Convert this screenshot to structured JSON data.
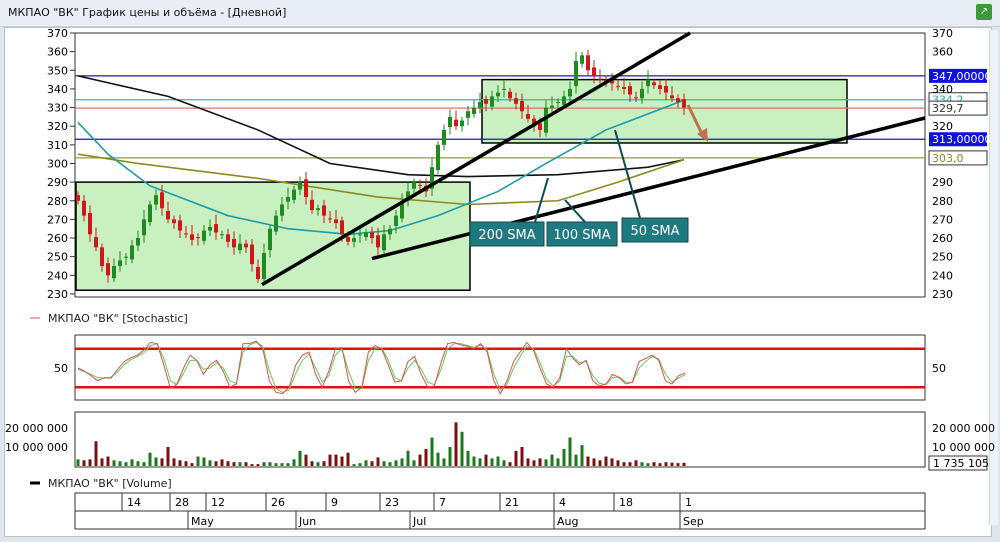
{
  "window": {
    "title": "МКПАО \"ВК\" График цены и объёма - [Дневной]",
    "pin_icon": "pin-icon"
  },
  "price_panel": {
    "y_ticks": [
      370,
      360,
      350,
      340,
      330,
      320,
      310,
      300,
      290,
      280,
      270,
      260,
      250,
      240,
      230
    ],
    "levels": [
      {
        "value": 347,
        "label": "347,00000",
        "color": "#1a1ab0",
        "tag_bg": "#1010e0",
        "tag_fg": "#ffffff"
      },
      {
        "value": 313,
        "label": "313,00000",
        "color": "#1a1ab0",
        "tag_bg": "#1010e0",
        "tag_fg": "#ffffff"
      },
      {
        "value": 334.2,
        "label": "334,2",
        "color": "#39b3b3",
        "tag_bg": "#ffffff",
        "tag_fg": "#39a0b0"
      },
      {
        "value": 329.7,
        "label": "329,7",
        "color": "#e07070",
        "tag_bg": "#ffffff",
        "tag_fg": "#333333"
      },
      {
        "value": 303.0,
        "label": "303,0",
        "color": "#9a9a40",
        "tag_bg": "#ffffff",
        "tag_fg": "#8a8a30"
      }
    ],
    "callouts": {
      "sma200": "200 SMA",
      "sma100": "100 SMA",
      "sma50": "50 SMA"
    },
    "closes": [
      280,
      272,
      262,
      255,
      245,
      240,
      245,
      248,
      250,
      256,
      260,
      270,
      278,
      283,
      276,
      270,
      268,
      264,
      262,
      259,
      260,
      264,
      266,
      263,
      262,
      258,
      255,
      257,
      255,
      246,
      238,
      252,
      265,
      272,
      278,
      282,
      286,
      290,
      282,
      275,
      276,
      272,
      270,
      268,
      262,
      258,
      260,
      262,
      263,
      260,
      255,
      262,
      265,
      272,
      280,
      285,
      290,
      288,
      285,
      298,
      310,
      318,
      325,
      320,
      323,
      328,
      330,
      333,
      332,
      336,
      338,
      340,
      335,
      332,
      328,
      324,
      320,
      318,
      330,
      331,
      333,
      336,
      340,
      355,
      358,
      350,
      347,
      345,
      344,
      343,
      341,
      340,
      337,
      335,
      340,
      345,
      342,
      340,
      338,
      335,
      333,
      330
    ],
    "sma200": [
      [
        0,
        347
      ],
      [
        15,
        336
      ],
      [
        30,
        318
      ],
      [
        42,
        300
      ],
      [
        55,
        294
      ],
      [
        65,
        293
      ],
      [
        80,
        294
      ],
      [
        95,
        298
      ],
      [
        101,
        302
      ]
    ],
    "sma100": [
      [
        0,
        305
      ],
      [
        10,
        300
      ],
      [
        30,
        292
      ],
      [
        50,
        282
      ],
      [
        65,
        278
      ],
      [
        80,
        280
      ],
      [
        90,
        290
      ],
      [
        101,
        302
      ]
    ],
    "sma50": [
      [
        0,
        322
      ],
      [
        5,
        305
      ],
      [
        12,
        288
      ],
      [
        25,
        272
      ],
      [
        35,
        265
      ],
      [
        45,
        262
      ],
      [
        52,
        264
      ],
      [
        60,
        272
      ],
      [
        70,
        285
      ],
      [
        78,
        300
      ],
      [
        88,
        318
      ],
      [
        101,
        334
      ]
    ]
  },
  "stochastic_panel": {
    "legend": "МКПАО \"ВК\" [Stochastic]",
    "y_tick": "50",
    "upper": 80,
    "lower": 20,
    "k": [
      50,
      45,
      38,
      30,
      35,
      34,
      48,
      60,
      66,
      70,
      78,
      90,
      88,
      55,
      18,
      25,
      50,
      70,
      62,
      40,
      55,
      62,
      45,
      20,
      25,
      88,
      88,
      92,
      80,
      30,
      12,
      10,
      20,
      55,
      70,
      75,
      40,
      20,
      45,
      80,
      82,
      30,
      12,
      20,
      75,
      85,
      80,
      55,
      28,
      30,
      60,
      68,
      40,
      20,
      22,
      58,
      88,
      90,
      86,
      84,
      80,
      88,
      75,
      30,
      10,
      30,
      60,
      75,
      90,
      78,
      50,
      25,
      20,
      35,
      80,
      65,
      55,
      62,
      30,
      22,
      25,
      40,
      35,
      25,
      28,
      60,
      65,
      70,
      62,
      30,
      25,
      38,
      42
    ],
    "d": [
      48,
      44,
      40,
      35,
      34,
      36,
      44,
      55,
      63,
      68,
      74,
      85,
      88,
      65,
      30,
      24,
      42,
      62,
      62,
      48,
      50,
      58,
      50,
      30,
      26,
      75,
      86,
      90,
      84,
      45,
      18,
      12,
      16,
      42,
      62,
      72,
      50,
      28,
      38,
      70,
      80,
      45,
      18,
      18,
      62,
      80,
      82,
      62,
      35,
      30,
      50,
      62,
      48,
      28,
      24,
      48,
      80,
      88,
      88,
      85,
      82,
      86,
      78,
      40,
      16,
      25,
      50,
      68,
      85,
      80,
      58,
      32,
      22,
      30,
      68,
      68,
      58,
      60,
      38,
      26,
      24,
      35,
      36,
      28,
      27,
      50,
      60,
      68,
      64,
      40,
      28,
      34,
      40
    ]
  },
  "volume_panel": {
    "legend": "МКПАО \"ВК\" [Volume]",
    "y_ticks": [
      "20 000 000",
      "10 000 000"
    ],
    "last_value": "1 735 105",
    "volumes": [
      3.5,
      3,
      3.5,
      13,
      4,
      5,
      3,
      2.5,
      2,
      3.5,
      2.5,
      2,
      7,
      4.5,
      4,
      10,
      4,
      3,
      2.5,
      1.5,
      5,
      4.5,
      3,
      2.5,
      3.5,
      2.5,
      2,
      2,
      2,
      1,
      1,
      2,
      2,
      1.5,
      1.5,
      1.5,
      3.5,
      8,
      6,
      2.5,
      2,
      2.5,
      6,
      6,
      5,
      7,
      1,
      1.5,
      3,
      2.5,
      4.5,
      2.5,
      2,
      3,
      4,
      8,
      3,
      6,
      9,
      15,
      7,
      4,
      10,
      23,
      18,
      8,
      5,
      4,
      6,
      4,
      5,
      3,
      2,
      8,
      10,
      4,
      3,
      4,
      3.5,
      6,
      4,
      9,
      15,
      6,
      11,
      5,
      4,
      3,
      5,
      4,
      3,
      2,
      2,
      3,
      2,
      1.5,
      2,
      1.5,
      2,
      1.8,
      1.5,
      1.7
    ]
  },
  "time_axis": {
    "days": [
      {
        "label": "14",
        "i": 6
      },
      {
        "label": "28",
        "i": 14
      },
      {
        "label": "12",
        "i": 20
      },
      {
        "label": "26",
        "i": 30
      },
      {
        "label": "9",
        "i": 40
      },
      {
        "label": "23",
        "i": 49
      },
      {
        "label": "7",
        "i": 58
      },
      {
        "label": "21",
        "i": 69
      },
      {
        "label": "4",
        "i": 78
      },
      {
        "label": "18",
        "i": 88
      },
      {
        "label": "1",
        "i": 99
      }
    ],
    "months": [
      {
        "label": "May",
        "i": 17
      },
      {
        "label": "Jun",
        "i": 35
      },
      {
        "label": "Jul",
        "i": 54
      },
      {
        "label": "Aug",
        "i": 78
      },
      {
        "label": "Sep",
        "i": 99
      }
    ]
  }
}
